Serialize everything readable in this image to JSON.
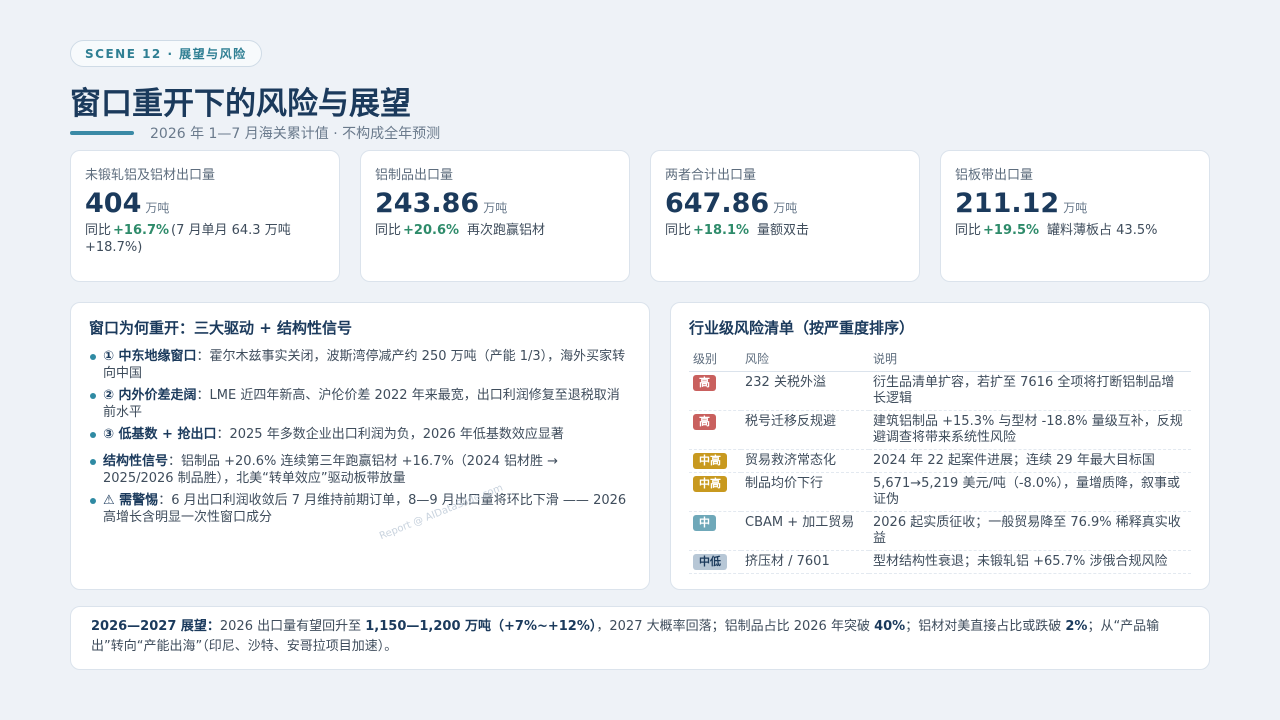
{
  "scene": "SCENE 12 · 展望与风险",
  "title": "窗口重开下的风险与展望",
  "subtitle": "2026 年 1—7 月海关累计值 · 不构成全年预测",
  "kpis": [
    {
      "label": "未锻轧铝及铝材出口量",
      "value": "404",
      "unit": "万吨",
      "prefix": "同比",
      "change": "+16.7%",
      "extra": "(7 月单月 64.3 万吨 +18.7%)"
    },
    {
      "label": "铝制品出口量",
      "value": "243.86",
      "unit": "万吨",
      "prefix": "同比",
      "change": "+20.6%",
      "extra": "再次跑赢铝材"
    },
    {
      "label": "两者合计出口量",
      "value": "647.86",
      "unit": "万吨",
      "prefix": "同比",
      "change": "+18.1%",
      "extra": "量额双击"
    },
    {
      "label": "铝板带出口量",
      "value": "211.12",
      "unit": "万吨",
      "prefix": "同比",
      "change": "+19.5%",
      "extra": "罐料薄板占 43.5%"
    }
  ],
  "drivers": {
    "title": "窗口为何重开：三大驱动 + 结构性信号",
    "items": [
      {
        "head": "① 中东地缘窗口",
        "text": "：霍尔木兹事实关闭，波斯湾停减产约 250 万吨（产能 1/3），海外买家转向中国"
      },
      {
        "head": "② 内外价差走阔",
        "text": "：LME 近四年新高、沪伦价差 2022 年来最宽，出口利润修复至退税取消前水平"
      },
      {
        "head": "③ 低基数 + 抢出口",
        "text": "：2025 年多数企业出口利润为负，2026 年低基数效应显著"
      },
      {
        "head": "结构性信号",
        "text": "：铝制品 +20.6% 连续第三年跑赢铝材 +16.7%（2024 铝材胜 → 2025/2026 制品胜），北美“转单效应”驱动板带放量"
      },
      {
        "head": "⚠ 需警惕",
        "text": "：6 月出口利润收敛后 7 月维持前期订单，8—9 月出口量将环比下滑 —— 2026 高增长含明显一次性窗口成分"
      }
    ]
  },
  "risks": {
    "title": "行业级风险清单（按严重度排序）",
    "headers": [
      "级别",
      "风险",
      "说明"
    ],
    "rows": [
      {
        "level": "高",
        "risk": "232 关税外溢",
        "desc": "衍生品清单扩容，若扩至 7616 全项将打断铝制品增长逻辑"
      },
      {
        "level": "高",
        "risk": "税号迁移反规避",
        "desc": "建筑铝制品 +15.3% 与型材 -18.8% 量级互补，反规避调查将带来系统性风险"
      },
      {
        "level": "中高",
        "risk": "贸易救济常态化",
        "desc": "2024 年 22 起案件进展；连续 29 年最大目标国"
      },
      {
        "level": "中高",
        "risk": "制品均价下行",
        "desc": "5,671→5,219 美元/吨（-8.0%），量增质降，叙事或证伪"
      },
      {
        "level": "中",
        "risk": "CBAM + 加工贸易",
        "desc": "2026 起实质征收；一般贸易降至 76.9% 稀释真实收益"
      },
      {
        "level": "中低",
        "risk": "挤压材 / 7601",
        "desc": "型材结构性衰退；未锻轧铝 +65.7% 涉俄合规风险"
      }
    ]
  },
  "outlook": {
    "head": "2026—2027 展望：",
    "p1": "2026 出口量有望回升至 ",
    "b1": "1,150—1,200 万吨（+7%~+12%）",
    "p2": "，2027 大概率回落；铝制品占比 2026 年突破 ",
    "b2": "40%",
    "p3": "；铝材对美直接占比或跌破 ",
    "b3": "2%",
    "p4": "；从“产品输出”转向“产能出海”（印尼、沙特、安哥拉项目加速）。"
  },
  "watermark": "Report @ AIDataSlide.com"
}
